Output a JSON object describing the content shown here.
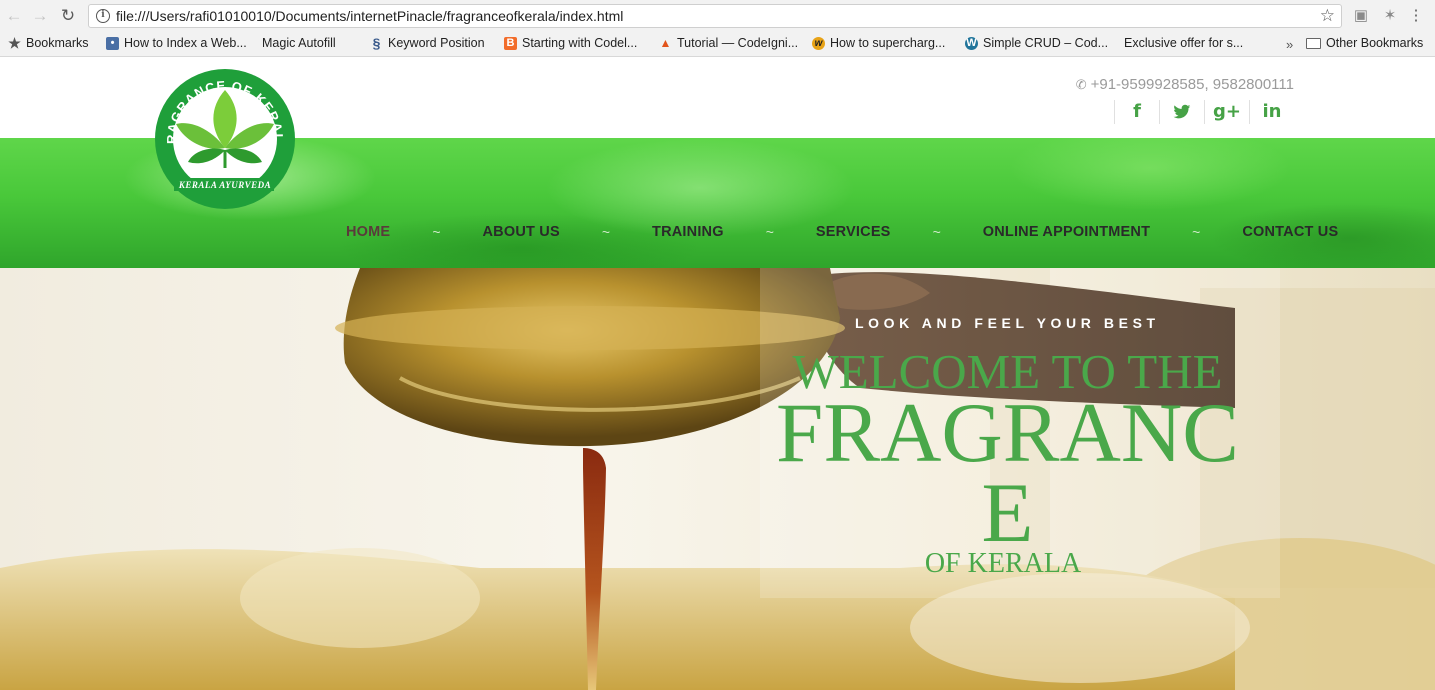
{
  "browser": {
    "url": "file:///Users/rafi01010010/Documents/internetPinacle/fragranceofkerala/index.html",
    "bookmarks": [
      {
        "label": "Bookmarks",
        "icon": "star-icon"
      },
      {
        "label": "How to Index a Web...",
        "icon": "site-icon"
      },
      {
        "label": "Magic Autofill",
        "icon": "page-icon"
      },
      {
        "label": "Keyword Position",
        "icon": "seo-icon"
      },
      {
        "label": "Starting with Codel...",
        "icon": "blogger-icon"
      },
      {
        "label": "Tutorial — CodeIgni...",
        "icon": "flame-icon"
      },
      {
        "label": "How to supercharg...",
        "icon": "w-icon"
      },
      {
        "label": "Simple CRUD – Cod...",
        "icon": "wordpress-icon"
      },
      {
        "label": "Exclusive offer for s...",
        "icon": "page-icon"
      }
    ],
    "other_bookmarks": "Other Bookmarks",
    "overflow": "»"
  },
  "site": {
    "logo": {
      "text_top": "FRAGRANCE OF KERALA",
      "text_bottom": "KERALA AYURVEDA",
      "icon": "leaf-logo-icon"
    },
    "phone": "+91-9599928585, 9582800111",
    "socials": [
      {
        "icon": "facebook-icon",
        "glyph": "f"
      },
      {
        "icon": "twitter-icon",
        "glyph": "t"
      },
      {
        "icon": "google-plus-icon",
        "glyph": "g+"
      },
      {
        "icon": "linkedin-icon",
        "glyph": "in"
      }
    ],
    "nav": [
      "HOME",
      "ABOUT US",
      "TRAINING",
      "SERVICES",
      "ONLINE APPOINTMENT",
      "CONTACT US"
    ],
    "nav_separator": "~",
    "hero": {
      "tagline": "LOOK AND FEEL YOUR BEST",
      "heading_line1": "WELCOME TO THE",
      "heading_line2": "FRAGRANC",
      "heading_line3": "E",
      "heading_line4": "OF KERALA"
    },
    "colors": {
      "brand_green": "#4aa84a",
      "nav_band": "#49c83a",
      "nav_text": "#2a2a2a"
    }
  }
}
